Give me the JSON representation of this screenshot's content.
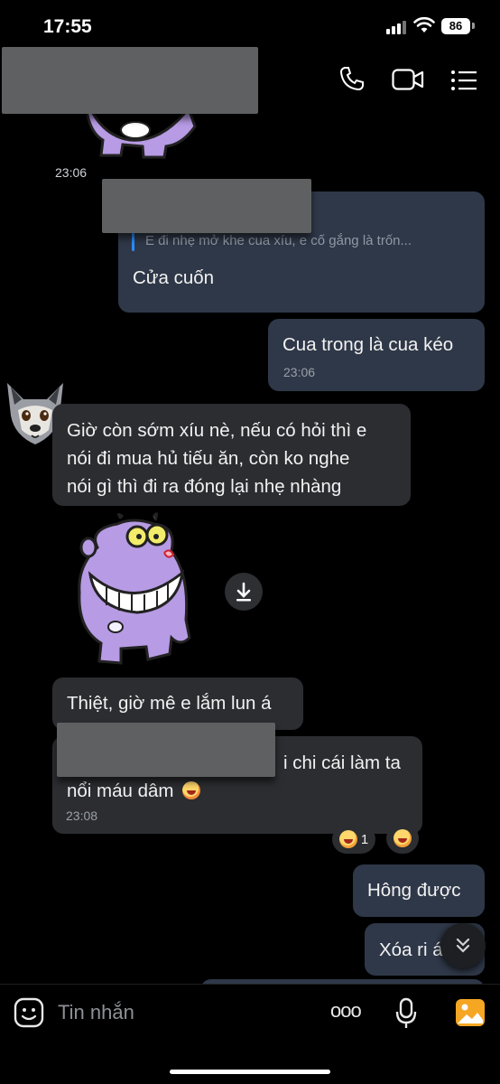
{
  "status_bar": {
    "time": "17:55",
    "battery": "86"
  },
  "header": {
    "icons": [
      "phone-icon",
      "video-call-icon",
      "menu-list-icon"
    ]
  },
  "messages": [
    {
      "time": "23:06"
    },
    {
      "quote": "E đi nhẹ mở khe cua xíu, e cố gắng là trốn...",
      "text": "Cửa cuốn"
    },
    {
      "text": "Cua trong là cua kéo",
      "time": "23:06"
    },
    {
      "lines": [
        "Giờ còn sớm xíu nè, nếu có hỏi thì e",
        "nói đi mua hủ tiếu ăn, còn ko nghe",
        "nói gì thì đi ra đóng lại nhẹ nhàng"
      ]
    },
    {
      "text": "Thiệt, giờ mê e lắm lun á"
    },
    {
      "line1": "i chi cái làm ta",
      "line2": "nổi máu dâm",
      "time": "23:08",
      "reaction_count": "1"
    },
    {
      "text": "Hông được"
    },
    {
      "text": "Xóa ri á"
    }
  ],
  "composer": {
    "placeholder": "Tin nhắn",
    "more": "ooo"
  },
  "colors": {
    "accent": "#2a8cff",
    "outgoing_bubble": "#2f3848",
    "incoming_bubble": "#2b2d31",
    "gallery": "#f5a623"
  }
}
